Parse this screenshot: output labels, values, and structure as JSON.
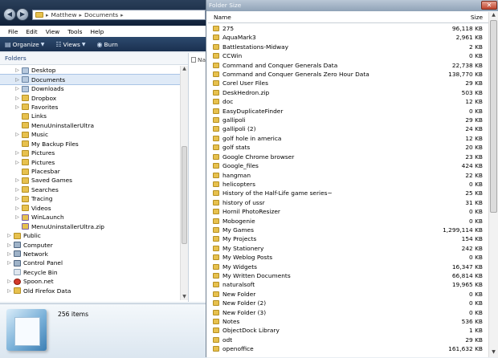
{
  "explorer": {
    "address": {
      "segments": [
        "Matthew",
        "Documents"
      ]
    },
    "menu": [
      "File",
      "Edit",
      "View",
      "Tools",
      "Help"
    ],
    "toolbar": {
      "organize": "Organize",
      "views": "Views",
      "burn": "Burn"
    },
    "nav_header": "Folders",
    "tree": [
      {
        "label": "Desktop",
        "indent": 1,
        "expander": "▷",
        "icon": "doc"
      },
      {
        "label": "Documents",
        "indent": 1,
        "expander": "▷",
        "icon": "doc",
        "selected": true
      },
      {
        "label": "Downloads",
        "indent": 1,
        "expander": "▷",
        "icon": "doc"
      },
      {
        "label": "Dropbox",
        "indent": 1,
        "expander": "▷",
        "icon": "folder"
      },
      {
        "label": "Favorites",
        "indent": 1,
        "expander": "▷",
        "icon": "folder"
      },
      {
        "label": "Links",
        "indent": 1,
        "expander": "",
        "icon": "folder"
      },
      {
        "label": "MenuUninstallerUltra",
        "indent": 1,
        "expander": "",
        "icon": "folder"
      },
      {
        "label": "Music",
        "indent": 1,
        "expander": "▷",
        "icon": "folder"
      },
      {
        "label": "My Backup Files",
        "indent": 1,
        "expander": "",
        "icon": "folder"
      },
      {
        "label": "Pictures",
        "indent": 1,
        "expander": "▷",
        "icon": "folder"
      },
      {
        "label": "Pictures",
        "indent": 1,
        "expander": "▷",
        "icon": "folder"
      },
      {
        "label": "Placesbar",
        "indent": 1,
        "expander": "",
        "icon": "folder"
      },
      {
        "label": "Saved Games",
        "indent": 1,
        "expander": "▷",
        "icon": "folder"
      },
      {
        "label": "Searches",
        "indent": 1,
        "expander": "▷",
        "icon": "folder"
      },
      {
        "label": "Tracing",
        "indent": 1,
        "expander": "▷",
        "icon": "folder"
      },
      {
        "label": "Videos",
        "indent": 1,
        "expander": "▷",
        "icon": "folder"
      },
      {
        "label": "WinLaunch",
        "indent": 1,
        "expander": "▷",
        "icon": "zip"
      },
      {
        "label": "MenuUninstallerUltra.zip",
        "indent": 1,
        "expander": "",
        "icon": "zip"
      },
      {
        "label": "Public",
        "indent": 0,
        "expander": "▷",
        "icon": "folder"
      },
      {
        "label": "Computer",
        "indent": 0,
        "expander": "▷",
        "icon": "pc"
      },
      {
        "label": "Network",
        "indent": 0,
        "expander": "▷",
        "icon": "pc"
      },
      {
        "label": "Control Panel",
        "indent": 0,
        "expander": "▷",
        "icon": "pc"
      },
      {
        "label": "Recycle Bin",
        "indent": 0,
        "expander": "",
        "icon": "bin"
      },
      {
        "label": "Spoon.net",
        "indent": 0,
        "expander": "▷",
        "icon": "red"
      },
      {
        "label": "Old Firefox Data",
        "indent": 0,
        "expander": "▷",
        "icon": "folder"
      }
    ],
    "files_header": "Na",
    "details": {
      "count": "256 items"
    }
  },
  "folder_size": {
    "title": "Folder Size",
    "columns": {
      "name": "Name",
      "size": "Size"
    },
    "rows": [
      {
        "name": "275",
        "size": "96,118 KB"
      },
      {
        "name": "AquaMark3",
        "size": "2,961 KB"
      },
      {
        "name": "Battlestations-Midway",
        "size": "2 KB"
      },
      {
        "name": "CCWin",
        "size": "0 KB"
      },
      {
        "name": "Command and Conquer Generals Data",
        "size": "22,738 KB"
      },
      {
        "name": "Command and Conquer Generals Zero Hour Data",
        "size": "138,770 KB"
      },
      {
        "name": "Corel User Files",
        "size": "29 KB"
      },
      {
        "name": "DeskHedron.zip",
        "size": "503 KB"
      },
      {
        "name": "doc",
        "size": "12 KB"
      },
      {
        "name": "EasyDuplicateFinder",
        "size": "0 KB"
      },
      {
        "name": "gallipoli",
        "size": "29 KB"
      },
      {
        "name": "gallipoli (2)",
        "size": "24 KB"
      },
      {
        "name": "golf hole in america",
        "size": "12 KB"
      },
      {
        "name": "golf stats",
        "size": "20 KB"
      },
      {
        "name": "Google Chrome browser",
        "size": "23 KB"
      },
      {
        "name": "Google_files",
        "size": "424 KB"
      },
      {
        "name": "hangman",
        "size": "22 KB"
      },
      {
        "name": "helicopters",
        "size": "0 KB"
      },
      {
        "name": "History of the Half-Life game series~",
        "size": "25 KB"
      },
      {
        "name": "history of ussr",
        "size": "31 KB"
      },
      {
        "name": "Hornil PhotoResizer",
        "size": "0 KB"
      },
      {
        "name": "Mobogenie",
        "size": "0 KB"
      },
      {
        "name": "My Games",
        "size": "1,299,114 KB"
      },
      {
        "name": "My Projects",
        "size": "154 KB"
      },
      {
        "name": "My Stationery",
        "size": "242 KB"
      },
      {
        "name": "My Weblog Posts",
        "size": "0 KB"
      },
      {
        "name": "My Widgets",
        "size": "16,347 KB"
      },
      {
        "name": "My Written Documents",
        "size": "66,814 KB"
      },
      {
        "name": "naturalsoft",
        "size": "19,965 KB"
      },
      {
        "name": "New Folder",
        "size": "0 KB"
      },
      {
        "name": "New Folder (2)",
        "size": "0 KB"
      },
      {
        "name": "New Folder (3)",
        "size": "0 KB"
      },
      {
        "name": "Notes",
        "size": "536 KB"
      },
      {
        "name": "ObjectDock Library",
        "size": "1 KB"
      },
      {
        "name": "odt",
        "size": "29 KB"
      },
      {
        "name": "openoffice",
        "size": "161,632 KB"
      }
    ]
  }
}
